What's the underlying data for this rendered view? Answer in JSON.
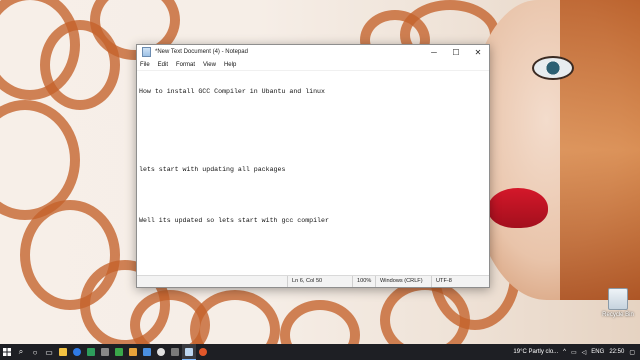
{
  "window": {
    "title": "*New Text Document (4) - Notepad",
    "controls": {
      "minimize": "─",
      "maximize": "☐",
      "close": "✕"
    }
  },
  "menu": [
    "File",
    "Edit",
    "Format",
    "View",
    "Help"
  ],
  "editor": {
    "lines": [
      "How to install GCC Compiler in Ubantu and linux",
      "",
      "",
      "lets start with updating all packages",
      "",
      "Well its updated so lets start with gcc compiler"
    ]
  },
  "status": {
    "position": "Ln 6, Col 50",
    "zoom": "100%",
    "line_endings": "Windows (CRLF)",
    "encoding": "UTF-8"
  },
  "desktop": {
    "recycle_bin_label": "Recycle Bin"
  },
  "taskbar": {
    "weather": "19°C  Partly clo...",
    "language": "ENG",
    "time": "22:50"
  },
  "colors": {
    "accent": "#7ab8ff",
    "taskbar": "#1e1f24",
    "wallpaper_hair": "#c4622a",
    "lips": "#d4182a"
  }
}
